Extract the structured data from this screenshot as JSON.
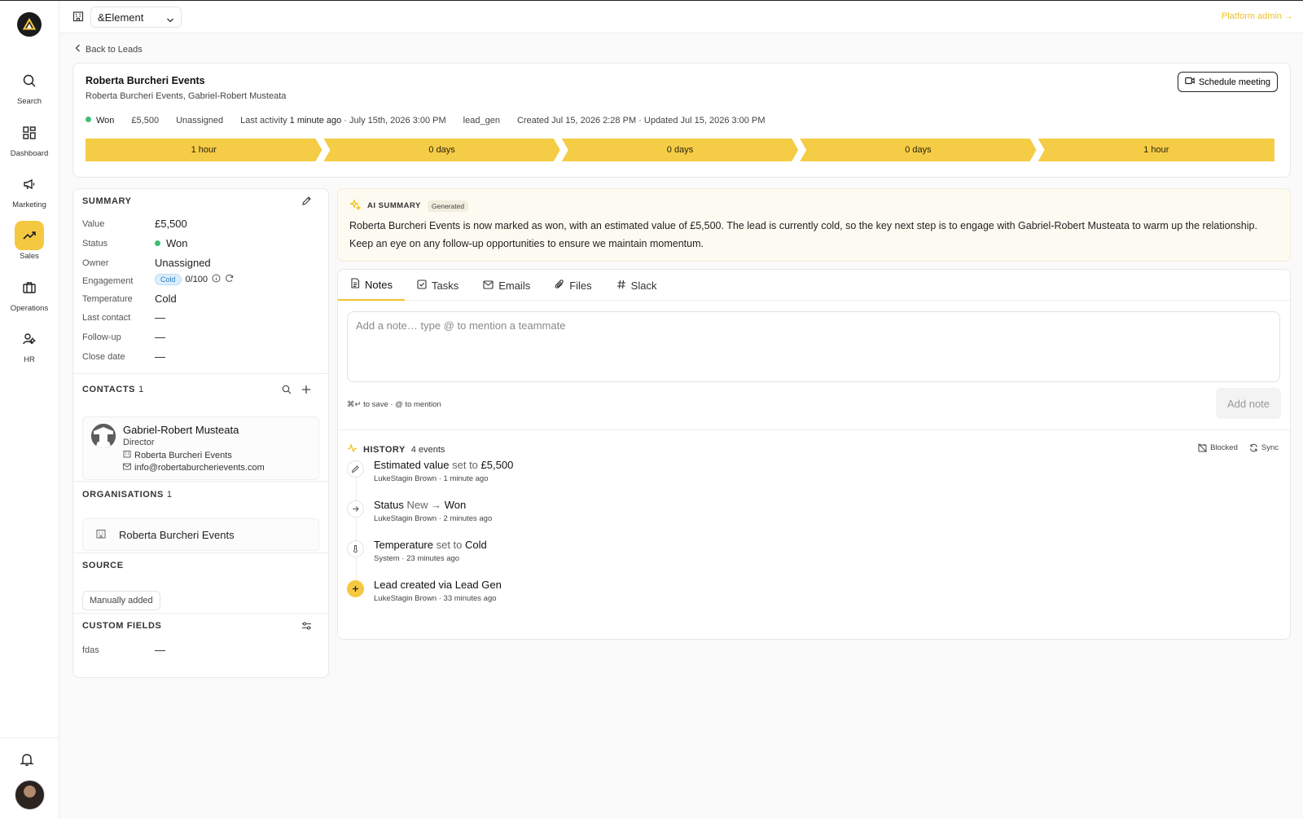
{
  "workspace": {
    "name": "&Element",
    "platform_admin": "Platform admin →"
  },
  "sidebar": {
    "items": [
      {
        "label": "Search",
        "icon": "search-icon"
      },
      {
        "label": "Dashboard",
        "icon": "dashboard-icon"
      },
      {
        "label": "Marketing",
        "icon": "megaphone-icon"
      },
      {
        "label": "Sales",
        "icon": "trend-up-icon",
        "active": true
      },
      {
        "label": "Operations",
        "icon": "briefcase-icon"
      },
      {
        "label": "HR",
        "icon": "users-icon"
      }
    ]
  },
  "back_link": "Back to Leads",
  "lead": {
    "title": "Roberta Burcheri Events",
    "subtitle": "Roberta Burcheri Events, Gabriel-Robert Musteata",
    "schedule_button": "Schedule meeting",
    "meta": {
      "status": "Won",
      "value": "£5,500",
      "owner": "Unassigned",
      "last_activity_label": "Last activity",
      "last_activity_value": "1 minute ago",
      "last_activity_date": " · July 15th, 2026 3:00 PM",
      "source_tag": "lead_gen",
      "created_updated": "Created Jul 15, 2026 2:28 PM · Updated Jul 15, 2026 3:00 PM"
    },
    "pipeline": [
      "1 hour",
      "0 days",
      "0 days",
      "0 days",
      "1 hour"
    ]
  },
  "summary": {
    "title": "SUMMARY",
    "rows": [
      {
        "label": "Value",
        "value": "£5,500"
      },
      {
        "label": "Status",
        "value": "Won"
      },
      {
        "label": "Owner",
        "value": "Unassigned"
      },
      {
        "label": "Engagement",
        "badge": "Cold",
        "score": "0/100"
      },
      {
        "label": "Temperature",
        "value": "Cold"
      },
      {
        "label": "Last contact",
        "value": "—"
      },
      {
        "label": "Follow-up",
        "value": "—"
      },
      {
        "label": "Close date",
        "value": "—"
      }
    ]
  },
  "contacts": {
    "title": "CONTACTS",
    "count": "1",
    "items": [
      {
        "name": "Gabriel-Robert Musteata",
        "role": "Director",
        "company": "Roberta Burcheri Events",
        "email": "info@robertaburcherievents.com"
      }
    ]
  },
  "organisations": {
    "title": "ORGANISATIONS",
    "count": "1",
    "items": [
      {
        "name": "Roberta Burcheri Events"
      }
    ]
  },
  "source": {
    "title": "SOURCE",
    "value": "Manually added"
  },
  "custom_fields": {
    "title": "CUSTOM FIELDS",
    "rows": [
      {
        "label": "fdas",
        "value": "—"
      }
    ]
  },
  "ai_summary": {
    "title": "AI SUMMARY",
    "tag": "Generated",
    "text": "Roberta Burcheri Events is now marked as won, with an estimated value of £5,500. The lead is currently cold, so the key next step is to engage with Gabriel-Robert Musteata to warm up the relationship. Keep an eye on any follow-up opportunities to ensure we maintain momentum."
  },
  "tabs": [
    {
      "label": "Notes",
      "active": true
    },
    {
      "label": "Tasks"
    },
    {
      "label": "Emails"
    },
    {
      "label": "Files"
    },
    {
      "label": "Slack"
    }
  ],
  "notes": {
    "placeholder": "Add a note… type @ to mention a teammate",
    "value": "",
    "hint": "⌘↵ to save · @ to mention",
    "add_button": "Add note"
  },
  "history": {
    "title": "HISTORY",
    "count": "4 events",
    "blocked": "Blocked",
    "sync": "Sync",
    "events": [
      {
        "t1": "Estimated value",
        "t2": " set to ",
        "t3": "£5,500",
        "sub": "LukeStagin Brown · 1 minute ago"
      },
      {
        "t1": "Status",
        "t2": " New → ",
        "t3": "Won",
        "sub": "LukeStagin Brown · 2 minutes ago"
      },
      {
        "t1": "Temperature",
        "t2": " set to ",
        "t3": "Cold",
        "sub": "System · 23 minutes ago"
      },
      {
        "t1": "Lead created via Lead Gen",
        "t2": "",
        "t3": "",
        "sub": "LukeStagin Brown · 33 minutes ago"
      }
    ]
  },
  "colors": {
    "accent": "#f5c842",
    "won": "#3fbf73",
    "cold": "#2f7bbd"
  }
}
